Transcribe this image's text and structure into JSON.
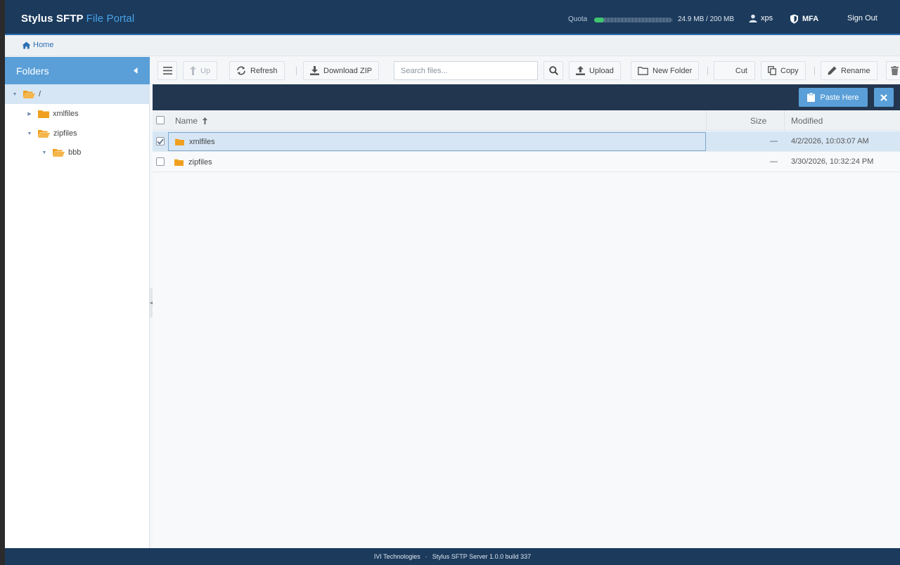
{
  "header": {
    "brand_main": "Stylus SFTP",
    "brand_accent": "File Portal",
    "quota_label": "Quota",
    "quota_text": "24.9 MB / 200 MB",
    "quota_fraction": 0.124,
    "user": "xps",
    "mfa": "MFA",
    "sign_out": "Sign Out"
  },
  "breadcrumb": {
    "home": "Home"
  },
  "sidebar": {
    "title": "Folders",
    "tree": [
      {
        "label": "/",
        "level": 0,
        "expanded": true,
        "selected": true
      },
      {
        "label": "xmlfiles",
        "level": 1,
        "expanded": false,
        "selected": false
      },
      {
        "label": "zipfiles",
        "level": 1,
        "expanded": true,
        "selected": false
      },
      {
        "label": "bbb",
        "level": 2,
        "expanded": true,
        "selected": false
      }
    ]
  },
  "toolbar": {
    "up": "Up",
    "refresh": "Refresh",
    "download_zip": "Download ZIP",
    "search_placeholder": "Search files...",
    "upload": "Upload",
    "new_folder": "New Folder",
    "cut": "Cut",
    "copy": "Copy",
    "rename": "Rename"
  },
  "pastebar": {
    "paste_here": "Paste Here"
  },
  "table": {
    "columns": {
      "name": "Name",
      "size": "Size",
      "modified": "Modified"
    },
    "rows": [
      {
        "name": "xmlfiles",
        "size": "—",
        "modified": "4/2/2026, 10:03:07 AM",
        "checked": true
      },
      {
        "name": "zipfiles",
        "size": "—",
        "modified": "3/30/2026, 10:32:24 PM",
        "checked": false
      }
    ]
  },
  "footer": {
    "company": "IVI Technologies",
    "separator": "·",
    "version": "Stylus SFTP Server 1.0.0 build 337"
  },
  "colors": {
    "header_bg": "#1b3a5c",
    "accent": "#5a9fd8",
    "folder": "#f0a020",
    "quota_fill": "#3ec56d",
    "selection": "#d6e6f5"
  }
}
